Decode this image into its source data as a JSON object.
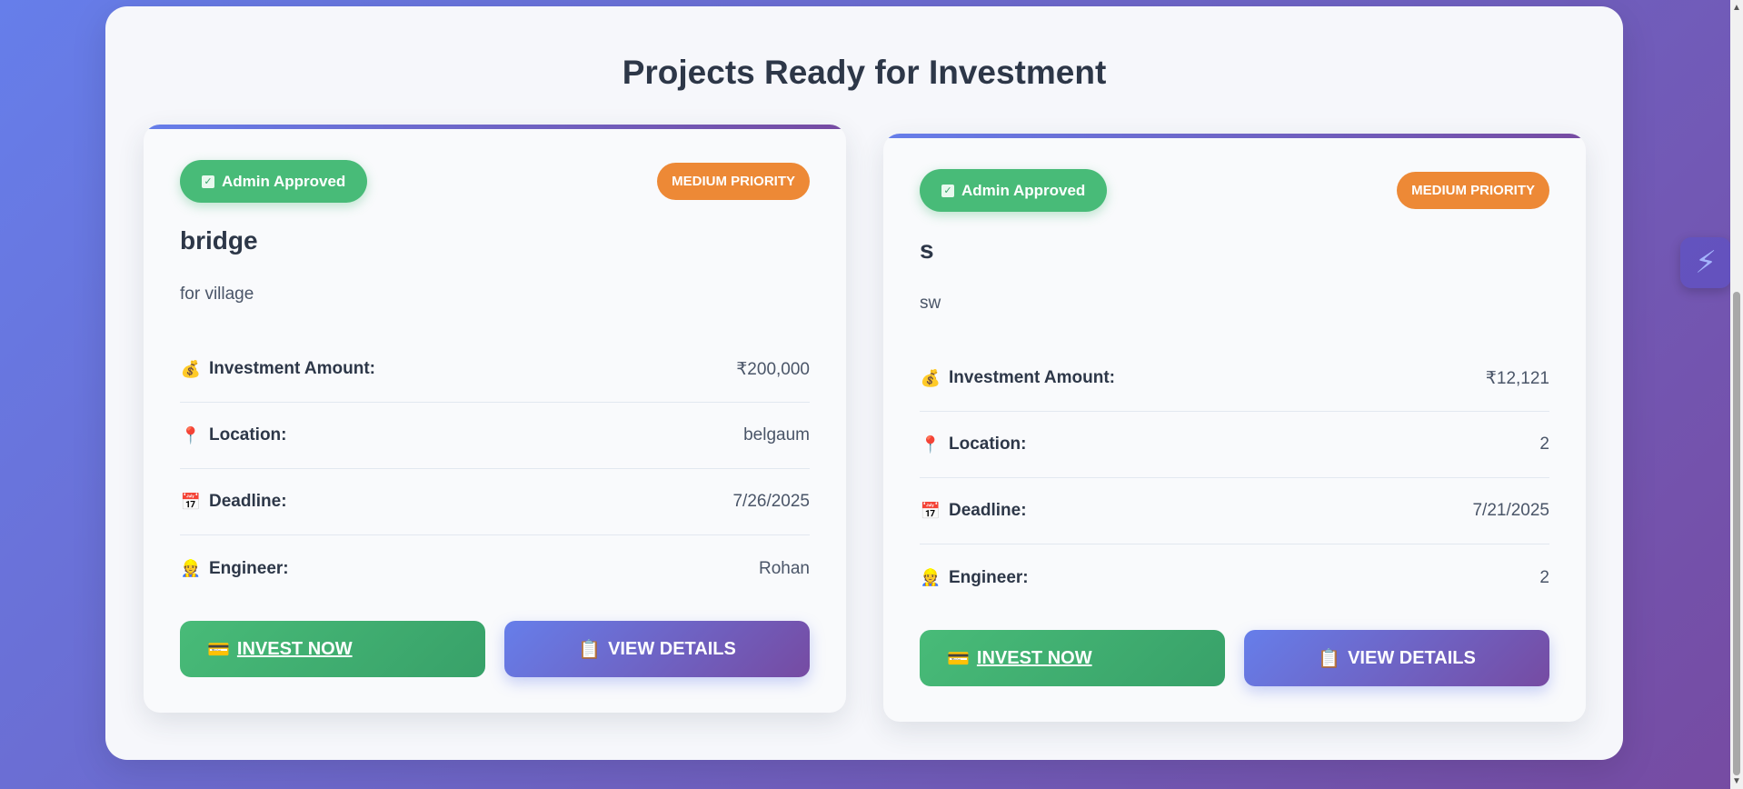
{
  "page": {
    "title": "Projects Ready for Investment"
  },
  "colors": {
    "approved": "#48bb78",
    "priority": "#ed8936",
    "accent_start": "#667eea",
    "accent_end": "#764ba2"
  },
  "cards": [
    {
      "approved_label": "Admin Approved",
      "priority_label": "MEDIUM PRIORITY",
      "title": "bridge",
      "description": "for village",
      "rows": [
        {
          "icon": "money-bag-icon",
          "glyph": "💰",
          "label": "Investment Amount:",
          "value": "₹200,000"
        },
        {
          "icon": "pin-icon",
          "glyph": "📍",
          "label": "Location:",
          "value": "belgaum"
        },
        {
          "icon": "calendar-icon",
          "glyph": "📅",
          "label": "Deadline:",
          "value": "7/26/2025"
        },
        {
          "icon": "engineer-icon",
          "glyph": "👷",
          "label": "Engineer:",
          "value": "Rohan"
        }
      ],
      "invest_label": "INVEST NOW",
      "invest_glyph": "💳",
      "view_label": "VIEW DETAILS",
      "view_glyph": "📋"
    },
    {
      "approved_label": "Admin Approved",
      "priority_label": "MEDIUM PRIORITY",
      "title": "s",
      "description": "sw",
      "rows": [
        {
          "icon": "money-bag-icon",
          "glyph": "💰",
          "label": "Investment Amount:",
          "value": "₹12,121"
        },
        {
          "icon": "pin-icon",
          "glyph": "📍",
          "label": "Location:",
          "value": "2"
        },
        {
          "icon": "calendar-icon",
          "glyph": "📅",
          "label": "Deadline:",
          "value": "7/21/2025"
        },
        {
          "icon": "engineer-icon",
          "glyph": "👷",
          "label": "Engineer:",
          "value": "2"
        }
      ],
      "invest_label": "INVEST NOW",
      "invest_glyph": "💳",
      "view_label": "VIEW DETAILS",
      "view_glyph": "📋"
    }
  ],
  "floating_button": {
    "icon": "lightning-icon",
    "glyph": "⚡"
  }
}
